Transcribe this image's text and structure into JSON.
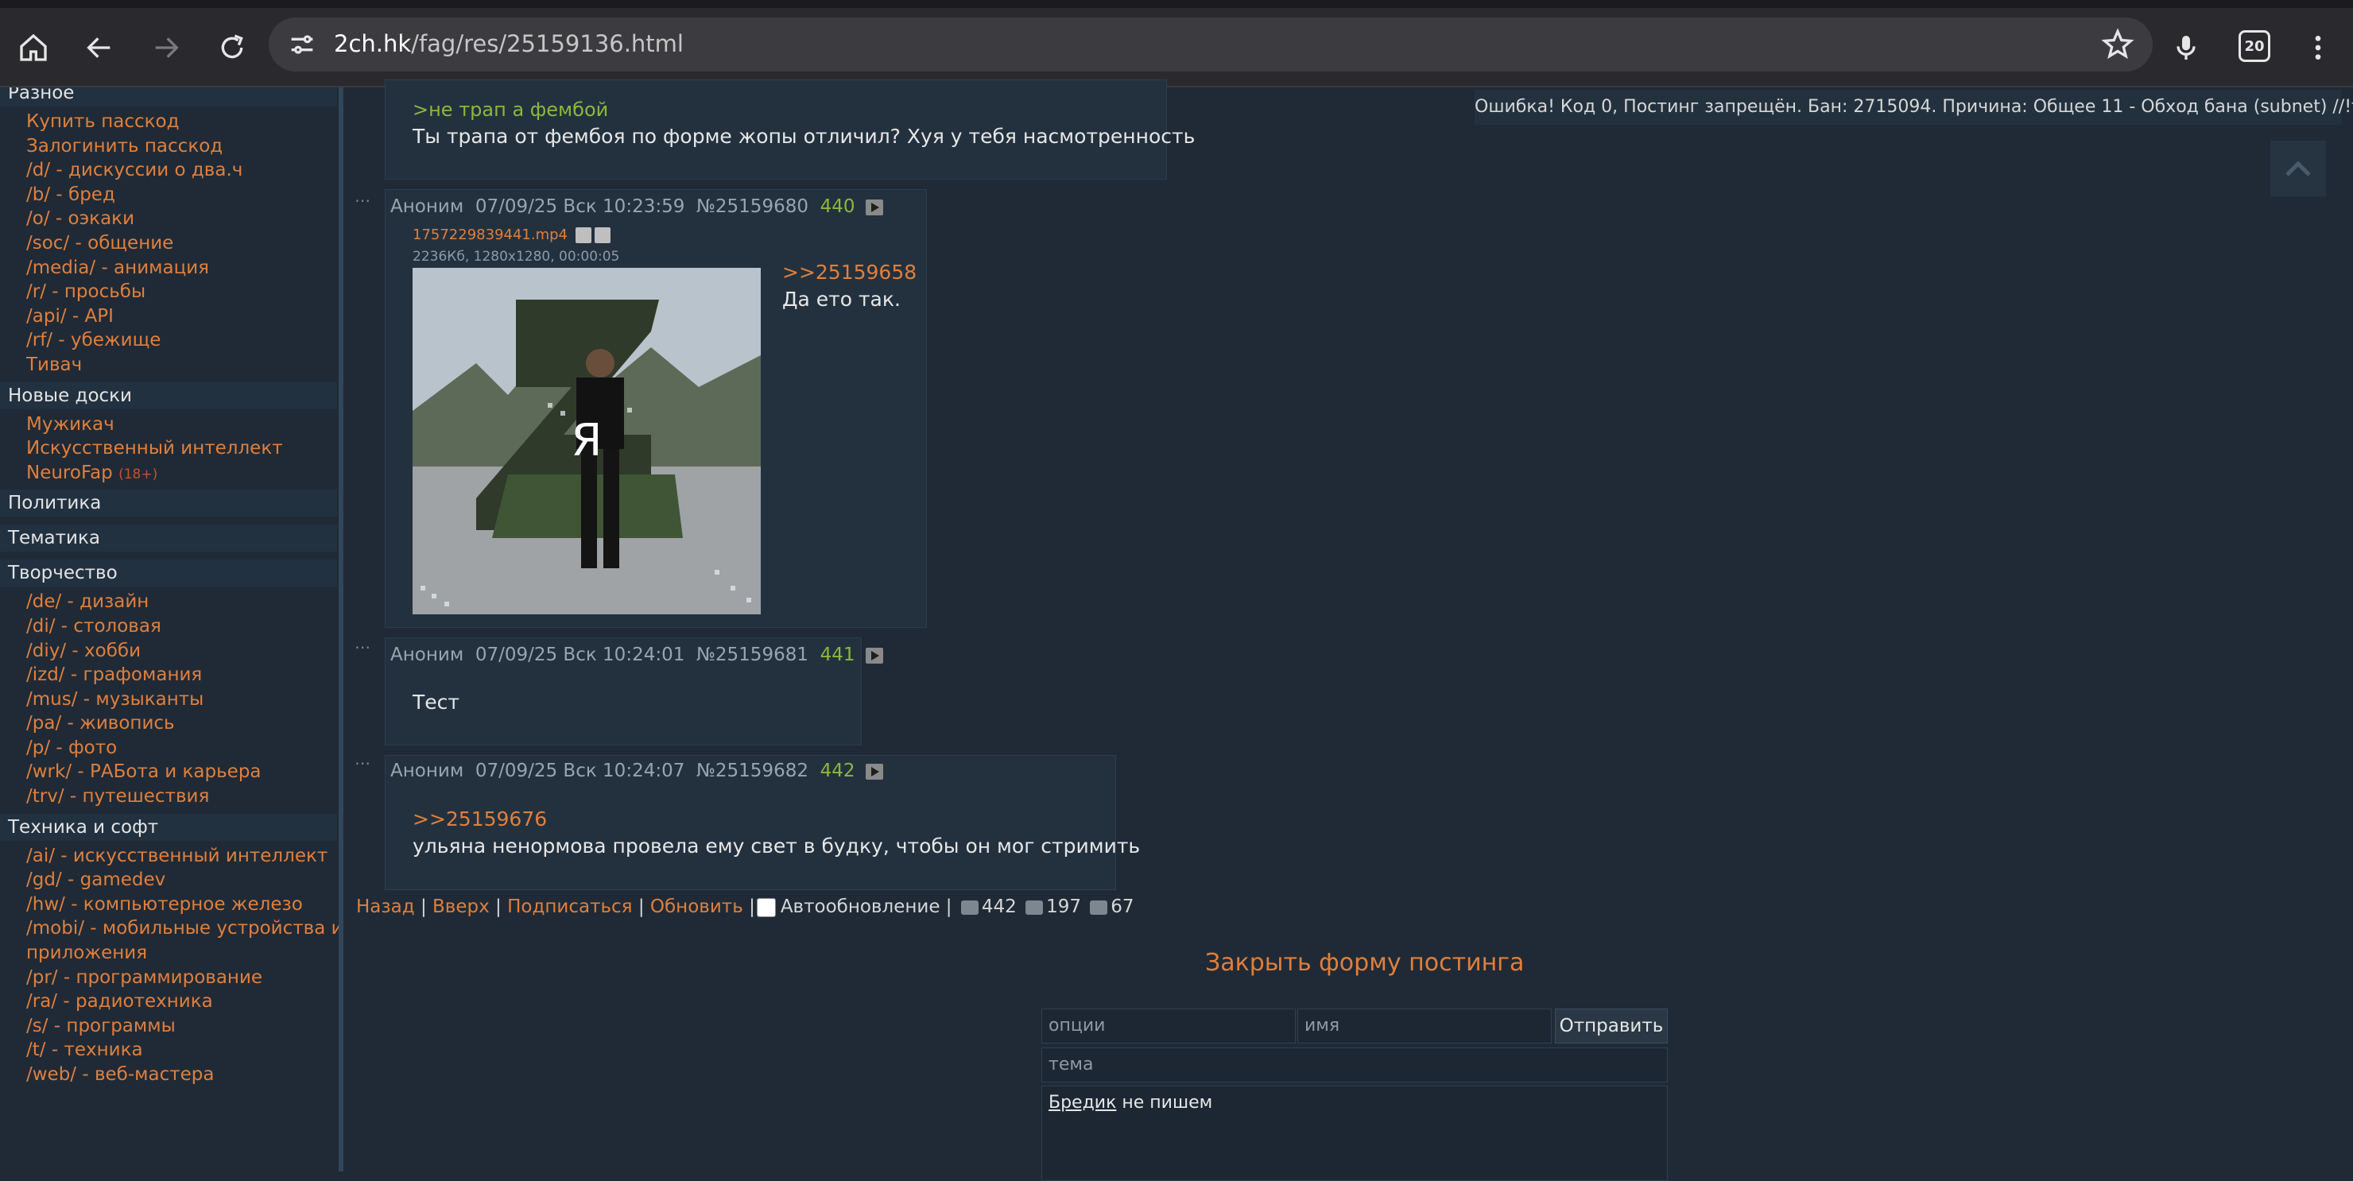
{
  "browser": {
    "url_host": "2ch.hk",
    "url_path": "/fag/res/25159136.html",
    "tab_count": "20"
  },
  "sidebar": {
    "sections": [
      {
        "title": "Разное",
        "items": [
          {
            "label": "Купить пасскод"
          },
          {
            "label": "Залогинить пасскод"
          },
          {
            "label": "/d/ - дискуссии о два.ч"
          },
          {
            "label": "/b/ - бред"
          },
          {
            "label": "/o/ - оэкаки"
          },
          {
            "label": "/soc/ - общение"
          },
          {
            "label": "/media/ - анимация"
          },
          {
            "label": "/r/ - просьбы"
          },
          {
            "label": "/api/ - API"
          },
          {
            "label": "/rf/ - убежище"
          },
          {
            "label": "Тивач"
          }
        ]
      },
      {
        "title": "Новые доски",
        "items": [
          {
            "label": "Мужикач"
          },
          {
            "label": "Искусственный интеллект"
          },
          {
            "label": "NeuroFap",
            "tag": "(18+)"
          }
        ]
      },
      {
        "title": "Политика",
        "items": []
      },
      {
        "title": "Тематика",
        "items": []
      },
      {
        "title": "Творчество",
        "items": [
          {
            "label": "/de/ - дизайн"
          },
          {
            "label": "/di/ - столовая"
          },
          {
            "label": "/diy/ - хобби"
          },
          {
            "label": "/izd/ - графомания"
          },
          {
            "label": "/mus/ - музыканты"
          },
          {
            "label": "/pa/ - живопись"
          },
          {
            "label": "/p/ - фото"
          },
          {
            "label": "/wrk/ - РАБота и карьера"
          },
          {
            "label": "/trv/ - путешествия"
          }
        ]
      },
      {
        "title": "Техника и софт",
        "items": [
          {
            "label": "/ai/ - искусственный интеллект"
          },
          {
            "label": "/gd/ - gamedev"
          },
          {
            "label": "/hw/ - компьютерное железо"
          },
          {
            "label": "/mobi/ - мобильные устройства и"
          },
          {
            "label": "приложения"
          },
          {
            "label": "/pr/ - программирование"
          },
          {
            "label": "/ra/ - радиотехника"
          },
          {
            "label": "/s/ - программы"
          },
          {
            "label": "/t/ - техника"
          },
          {
            "label": "/web/ - веб-мастера"
          }
        ]
      }
    ]
  },
  "error_message": "Ошибка! Код 0, Постинг запрещён. Бан: 2715094. Причина: Общее 11 - Обход бана (subnet) //!fag.",
  "posts": {
    "p0": {
      "quote": ">не трап а фембой",
      "text": "Ты трапа от фембоя по форме жопы отличил? Хуя у тебя насмотренность"
    },
    "p1": {
      "author": "Аноним",
      "date": "07/09/25 Вск 10:23:59",
      "num": "№25159680",
      "count": "440",
      "file_name": "1757229839441.mp4",
      "file_meta": "2236Кб, 1280x1280, 00:00:05",
      "thumb_letter": "Я",
      "reply_link": ">>25159658",
      "text": "Да ето так."
    },
    "p2": {
      "author": "Аноним",
      "date": "07/09/25 Вск 10:24:01",
      "num": "№25159681",
      "count": "441",
      "text": "Тест"
    },
    "p3": {
      "author": "Аноним",
      "date": "07/09/25 Вск 10:24:07",
      "num": "№25159682",
      "count": "442",
      "reply_link": ">>25159676",
      "text": "ульяна ненормова провела ему свет в будку, чтобы он мог стримить"
    }
  },
  "navbar": {
    "back": "Назад",
    "up": "Вверх",
    "subscribe": "Подписаться",
    "refresh": "Обновить",
    "autoupdate": "Автообновление",
    "posts_count": "442",
    "files_count": "197",
    "posters_count": "67",
    "sep": "|"
  },
  "form": {
    "close_label": "Закрыть форму постинга",
    "options_placeholder": "опции",
    "name_placeholder": "имя",
    "subject_placeholder": "тема",
    "send_label": "Отправить",
    "text_link": "Бредик",
    "text_rest": " не пишем"
  },
  "colors": {
    "background": "#1f2a36",
    "link": "#e07f3c",
    "quote": "#8db73a",
    "post_bg": "#23313f"
  }
}
